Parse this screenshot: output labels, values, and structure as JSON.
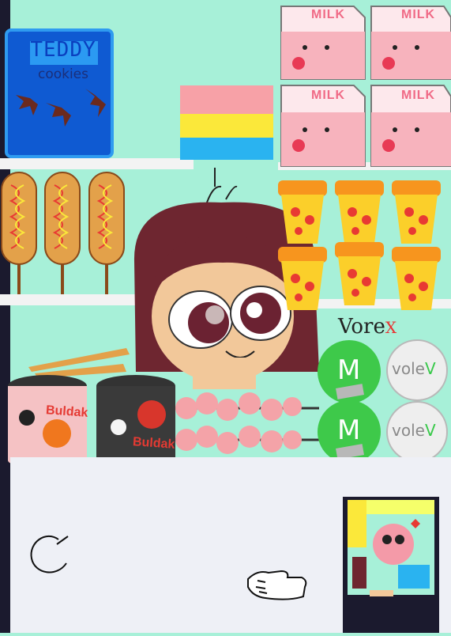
{
  "shelf_items": {
    "cookie_box": {
      "brand": "TEDDY",
      "product": "cookies"
    },
    "milk_label": "MILK",
    "ramen_label": "Buldak",
    "snack_mark": "M",
    "volev_brand": {
      "text": "vole",
      "accent": "V"
    },
    "counter_sign": {
      "text": "Vore",
      "accent": "X"
    }
  },
  "flag_colors": [
    "#f7a1a7",
    "#fbe83a",
    "#2ab3f0"
  ],
  "colors": {
    "background": "#a7f0d8",
    "counter": "#eef0f6",
    "shelf": "#f3f3f3",
    "left_wall": "#1b1a2e",
    "hair": "#6e2630",
    "pizza": "#f7951e"
  },
  "controls": {
    "reload": "reload-icon",
    "grab": "grab-hand-icon",
    "preview": "preview-thumbnail"
  }
}
